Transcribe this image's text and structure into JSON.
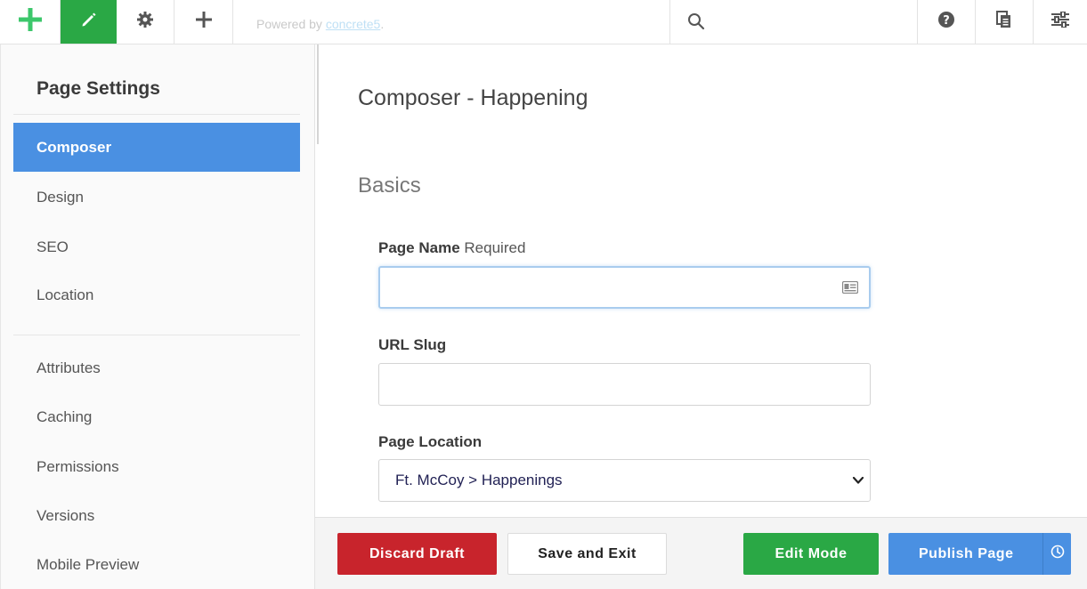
{
  "toolbar": {
    "powered_prefix": "Powered by ",
    "powered_link": "concrete5",
    "powered_suffix": ".",
    "search_placeholder": "",
    "accent_green": "#2aa845"
  },
  "sidebar": {
    "title": "Page Settings",
    "items": [
      {
        "label": "Composer",
        "active": true
      },
      {
        "label": "Design"
      },
      {
        "label": "SEO"
      },
      {
        "label": "Location"
      },
      {
        "label": "Attributes"
      },
      {
        "label": "Caching"
      },
      {
        "label": "Permissions"
      },
      {
        "label": "Versions"
      },
      {
        "label": "Mobile Preview"
      }
    ]
  },
  "main": {
    "title": "Composer - Happening",
    "section": "Basics",
    "fields": {
      "page_name_label": "Page Name",
      "page_name_required": "Required",
      "page_name_value": "",
      "url_slug_label": "URL Slug",
      "url_slug_value": "",
      "page_location_label": "Page Location",
      "page_location_value": "Ft. McCoy > Happenings"
    }
  },
  "footer": {
    "discard": "Discard Draft",
    "save_exit": "Save and Exit",
    "edit_mode": "Edit Mode",
    "publish": "Publish Page"
  },
  "icons": [
    "plus-logo-icon",
    "pencil-icon",
    "gear-icon",
    "plus-icon",
    "search-icon",
    "help-icon",
    "pages-icon",
    "sliders-icon",
    "card-icon",
    "chevron-down-icon",
    "clock-icon"
  ]
}
